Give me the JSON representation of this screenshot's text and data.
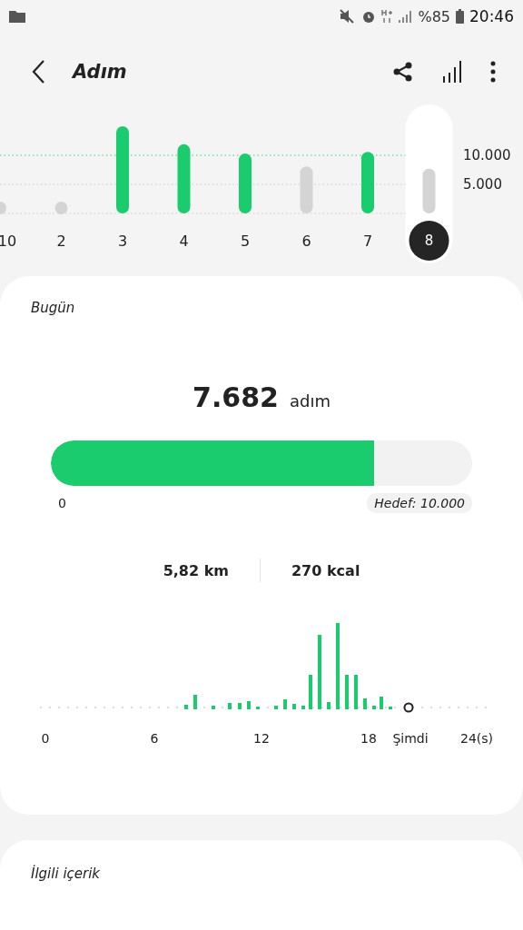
{
  "status_bar": {
    "battery_text": "%85",
    "time": "20:46"
  },
  "app_bar": {
    "title": "Adım"
  },
  "week_chart": {
    "selected": [
      false,
      false,
      false,
      false,
      false,
      false,
      false,
      true
    ],
    "chart_data": {
      "type": "bar",
      "categories": [
        "10",
        "2",
        "3",
        "4",
        "5",
        "6",
        "7",
        "8"
      ],
      "ylim": [
        0,
        15000
      ],
      "yticks": [
        {
          "value": 5000,
          "label": "5.000"
        },
        {
          "value": 10000,
          "label": "10.000"
        }
      ],
      "series": [
        {
          "color": "#1bcc6e",
          "values": [
            null,
            null,
            15000,
            11900,
            10300,
            null,
            10600,
            null
          ]
        },
        {
          "color": "#d4d4d4",
          "values": [
            0,
            0,
            null,
            null,
            null,
            8100,
            null,
            7700
          ]
        }
      ]
    }
  },
  "today": {
    "heading": "Bugün",
    "steps": "7.682",
    "unit": "adım",
    "progress": {
      "level": 0.7682,
      "start": "0",
      "goal": "Hedef: 10.000"
    },
    "distance": "5,82 km",
    "calories": "270 kcal",
    "hourly_axis": [
      "0",
      "6",
      "12",
      "18",
      "Şimdi",
      "24(s)"
    ]
  },
  "related": {
    "heading": "İlgili içerik"
  }
}
